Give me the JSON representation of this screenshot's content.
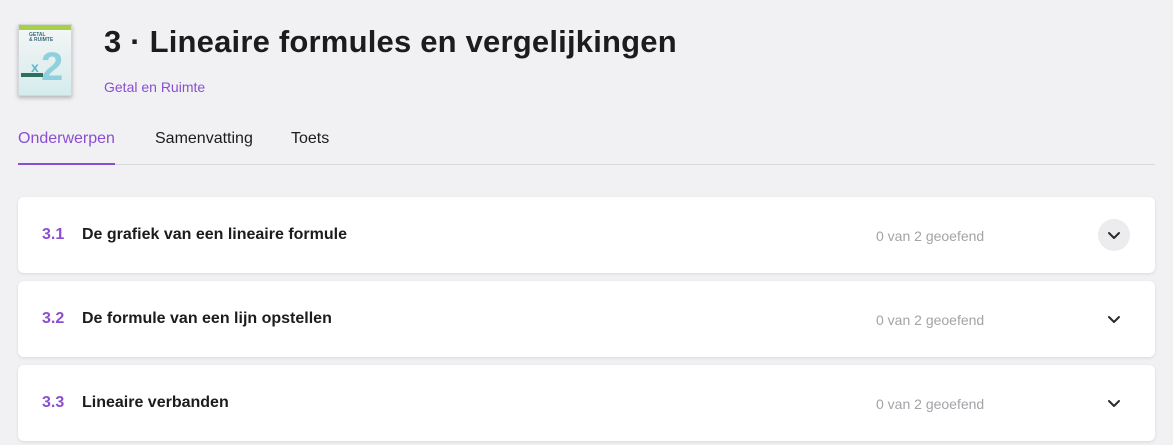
{
  "header": {
    "title": "3 · Lineaire formules en vergelijkingen",
    "method_link": "Getal en Ruimte",
    "cover": {
      "publisher_line1": "GETAL",
      "publisher_line2": "& RUIMTE",
      "volume": "2",
      "icon": "book-cover-image"
    }
  },
  "tabs": [
    {
      "label": "Onderwerpen",
      "active": true
    },
    {
      "label": "Samenvatting",
      "active": false
    },
    {
      "label": "Toets",
      "active": false
    }
  ],
  "topics": [
    {
      "number": "3.1",
      "title": "De grafiek van een lineaire formule",
      "progress": "0 van 2 geoefend",
      "icon": "chevron-down-icon",
      "hovered": true
    },
    {
      "number": "3.2",
      "title": "De formule van een lijn opstellen",
      "progress": "0 van 2 geoefend",
      "icon": "chevron-down-icon",
      "hovered": false
    },
    {
      "number": "3.3",
      "title": "Lineaire verbanden",
      "progress": "0 van 2 geoefend",
      "icon": "chevron-down-icon",
      "hovered": false
    }
  ],
  "colors": {
    "accent": "#8a4fd0",
    "background": "#f1f1f3",
    "card": "#ffffff",
    "muted_text": "#a3a3a8"
  }
}
